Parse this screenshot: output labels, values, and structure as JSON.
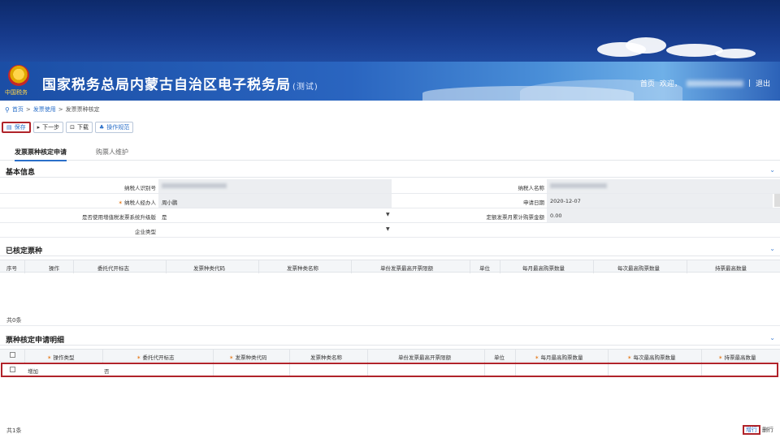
{
  "header": {
    "emblem_text": "中国税务",
    "title": "国家税务总局内蒙古自治区电子税务局",
    "title_suffix": "(测试)",
    "home_link": "首页",
    "welcome": "欢迎，",
    "separator": "|",
    "logout": "退出"
  },
  "breadcrumb": {
    "items": [
      "首页",
      "发票使用",
      "发票票种核定"
    ],
    "separator": ">"
  },
  "toolbar": {
    "save": "保存",
    "next": "下一步",
    "download": "下载",
    "guide": "操作规范"
  },
  "tabs": [
    {
      "label": "发票票种核定申请",
      "active": true
    },
    {
      "label": "购票人维护",
      "active": false
    }
  ],
  "basic_info": {
    "title": "基本信息",
    "taxpayer_id_label": "纳税人识别号",
    "taxpayer_name_label": "纳税人名称",
    "agent_label": "纳税人经办人",
    "agent_value": "周小鹏",
    "apply_date_label": "申请日期",
    "apply_date_value": "2020-12-07",
    "upgrade_label": "是否使用增值税发票系统升级版",
    "upgrade_value": "是",
    "quota_label": "定额发票月累计购票金额",
    "quota_value": "0.00",
    "company_type_label": "企业类型",
    "company_type_value": ""
  },
  "approved_types": {
    "title": "已核定票种",
    "columns": [
      "序号",
      "操作",
      "委托代开标志",
      "发票种类代码",
      "发票种类名称",
      "单份发票最高开票限额",
      "单位",
      "每月最高购票数量",
      "每次最高购票数量",
      "持票最高数量"
    ],
    "count_text": "共0条"
  },
  "detail": {
    "title": "票种核定申请明细",
    "columns": [
      "操作类型",
      "委托代开标志",
      "发票种类代码",
      "发票种类名称",
      "单份发票最高开票限额",
      "单位",
      "每月最高购票数量",
      "每次最高购票数量",
      "持票最高数量"
    ],
    "required_columns": [
      true,
      true,
      true,
      false,
      false,
      false,
      true,
      true,
      true
    ],
    "rows": [
      {
        "op_type": "增加",
        "agent_flag": "否"
      }
    ],
    "count_text": "共1条",
    "add_row": "增行",
    "del_row": "删行"
  },
  "colors": {
    "accent": "#2a6fc9",
    "highlight": "#b0232a",
    "required": "#e67e22"
  }
}
